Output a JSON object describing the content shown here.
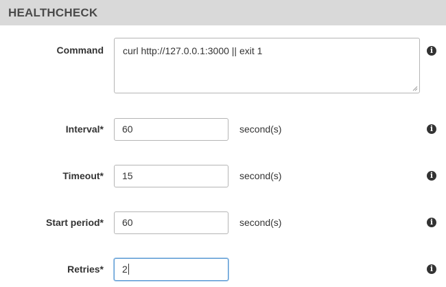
{
  "section": {
    "title": "HEALTHCHECK"
  },
  "fields": {
    "command": {
      "label": "Command",
      "value": "curl http://127.0.0.1:3000 || exit 1"
    },
    "interval": {
      "label": "Interval*",
      "value": "60",
      "unit": "second(s)"
    },
    "timeout": {
      "label": "Timeout*",
      "value": "15",
      "unit": "second(s)"
    },
    "start_period": {
      "label": "Start period*",
      "value": "60",
      "unit": "second(s)"
    },
    "retries": {
      "label": "Retries*",
      "value": "2"
    }
  },
  "icons": {
    "info": "i"
  },
  "colors": {
    "header_bg": "#d9d9d9",
    "focus_border": "#5b9bd5"
  }
}
